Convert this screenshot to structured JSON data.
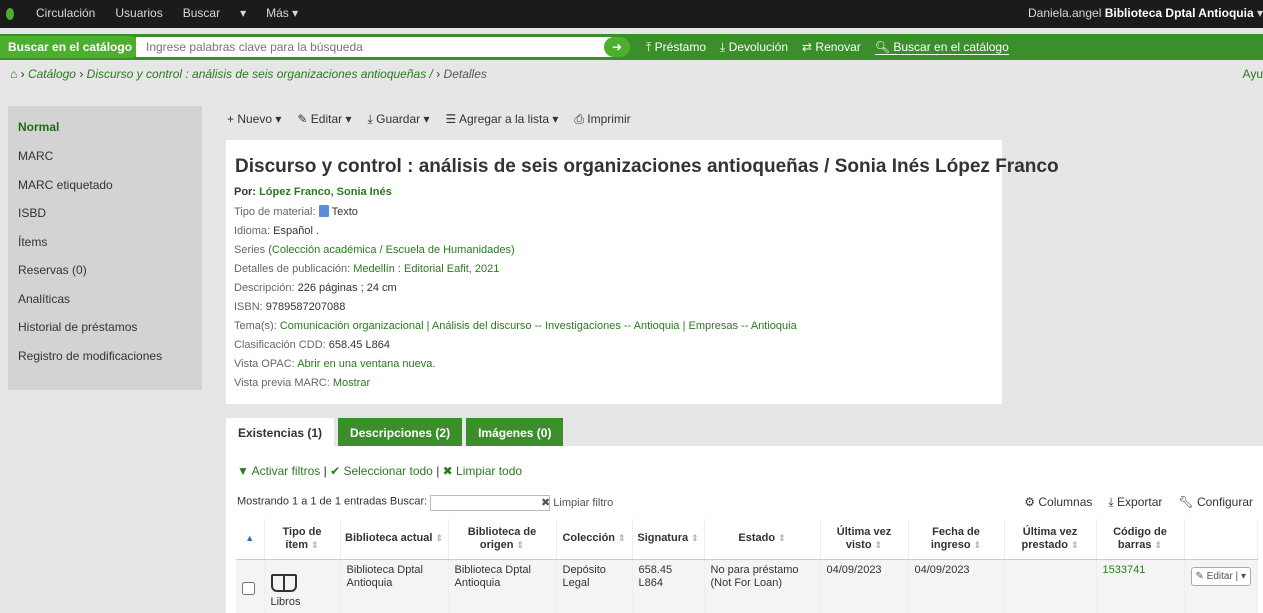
{
  "topbar": {
    "nav": [
      "Circulación",
      "Usuarios",
      "Buscar",
      "▾",
      "Más ▾"
    ],
    "user_name": "Daniela.angel",
    "library": "Biblioteca Dptal Antioquia",
    "caret": "▾"
  },
  "search": {
    "label": "Buscar en el catálogo",
    "placeholder": "Ingrese palabras clave para la búsqueda",
    "go": "➜",
    "links": [
      "Préstamo",
      "Devolución",
      "Renovar",
      "Buscar en el catálogo"
    ]
  },
  "breadcrumb": {
    "home_icon": "home-icon",
    "sep": "›",
    "catalog": "Catálogo",
    "record": "Discurso y control : análisis de seis organizaciones antioqueñas /",
    "current": "Detalles",
    "help": "Ayu"
  },
  "sidebar": {
    "items": [
      "Normal",
      "MARC",
      "MARC etiquetado",
      "ISBD",
      "Ítems",
      "Reservas (0)",
      "Analíticas",
      "Historial de préstamos",
      "Registro de modificaciones"
    ]
  },
  "toolbar": {
    "new": "+ Nuevo ▾",
    "edit": "✎ Editar ▾",
    "save": "⤓ Guardar ▾",
    "addlist": "☰ Agregar a la lista ▾",
    "print": "⎙ Imprimir"
  },
  "record": {
    "title": "Discurso y control : análisis de seis organizaciones antioqueñas / Sonia Inés López Franco",
    "by_label": "Por:",
    "author": "López Franco, Sonia Inés",
    "material_label": "Tipo de material:",
    "material": "Texto",
    "language_label": "Idioma:",
    "language": "Español .",
    "series_label": "Series",
    "series": "(Colección académica / Escuela de Humanidades)",
    "pub_label": "Detalles de publicación:",
    "pub": "Medellín : Editorial Eafit, 2021",
    "desc_label": "Descripción:",
    "desc": "226 páginas ; 24 cm",
    "isbn_label": "ISBN:",
    "isbn": "9789587207088",
    "subjects_label": "Tema(s):",
    "subjects": "Comunicación organizacional | Análisis del discurso -- Investigaciones -- Antioquia | Empresas -- Antioquia",
    "cdd_label": "Clasificación CDD:",
    "cdd": "658.45 L864",
    "opac_label": "Vista OPAC:",
    "opac": "Abrir en una ventana nueva.",
    "marc_label": "Vista previa MARC:",
    "marc": "Mostrar"
  },
  "tabs": [
    "Existencias (1)",
    "Descripciones (2)",
    "Imágenes (0)"
  ],
  "holdings": {
    "filters": {
      "activate": "Activar filtros",
      "select_all": "Seleccionar todo",
      "clear_all": "Limpiar todo",
      "sep": "|"
    },
    "showing": "Mostrando 1 a 1 de 1 entradas",
    "search_label": "Buscar:",
    "clear_filter": "Limpiar filtro",
    "columns": "Columnas",
    "export": "Exportar",
    "configure": "Configurar",
    "headers": [
      "Tipo de ítem",
      "Biblioteca actual",
      "Biblioteca de origen",
      "Colección",
      "Signatura",
      "Estado",
      "Última vez visto",
      "Fecha de ingreso",
      "Última vez prestado",
      "Código de barras"
    ],
    "rows": [
      {
        "type": "Libros",
        "current_lib": "Biblioteca Dptal Antioquia",
        "home_lib": "Biblioteca Dptal Antioquia",
        "collection": "Depósito Legal",
        "callnumber": "658.45 L864",
        "status": "No para préstamo (Not For Loan)",
        "last_seen": "04/09/2023",
        "accession": "04/09/2023",
        "last_borrowed": "",
        "barcode": "1533741",
        "edit": "✎ Editar",
        "menu": "▾"
      }
    ]
  }
}
